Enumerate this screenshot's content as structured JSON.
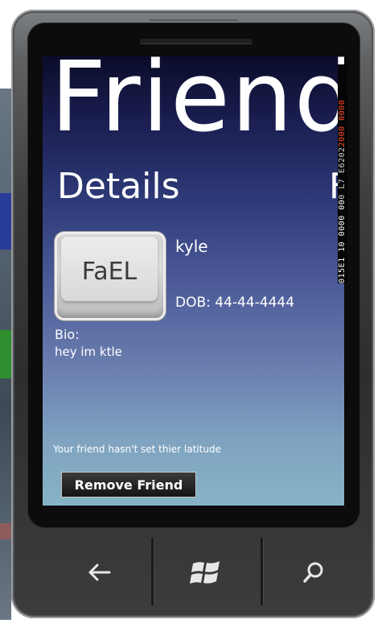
{
  "app": {
    "title": "Friend",
    "pivot_current": "Details",
    "pivot_next_partial": "F"
  },
  "profile": {
    "avatar_text": "FaEL",
    "name": "kyle",
    "dob": "DOB: 44-44-4444",
    "bio_label": "Bio:",
    "bio_text": "hey im ktle",
    "latitude_status": "Your friend hasn't set thier latitude"
  },
  "actions": {
    "remove_friend_label": "Remove Friend"
  },
  "debug_counter": {
    "segment_1": "015E1 10 0000 00",
    "segment_2": "0 L7 E6202",
    "segment_3": "2000 0000"
  },
  "hardware_keys": [
    "back-icon",
    "windows-start-icon",
    "search-icon"
  ],
  "colors": {
    "screen_top": "#0b0c2a",
    "screen_bottom": "#87b3c6",
    "text": "#ffffff",
    "button_bg": "#151515",
    "counter_accent": "#ff4b2b"
  }
}
